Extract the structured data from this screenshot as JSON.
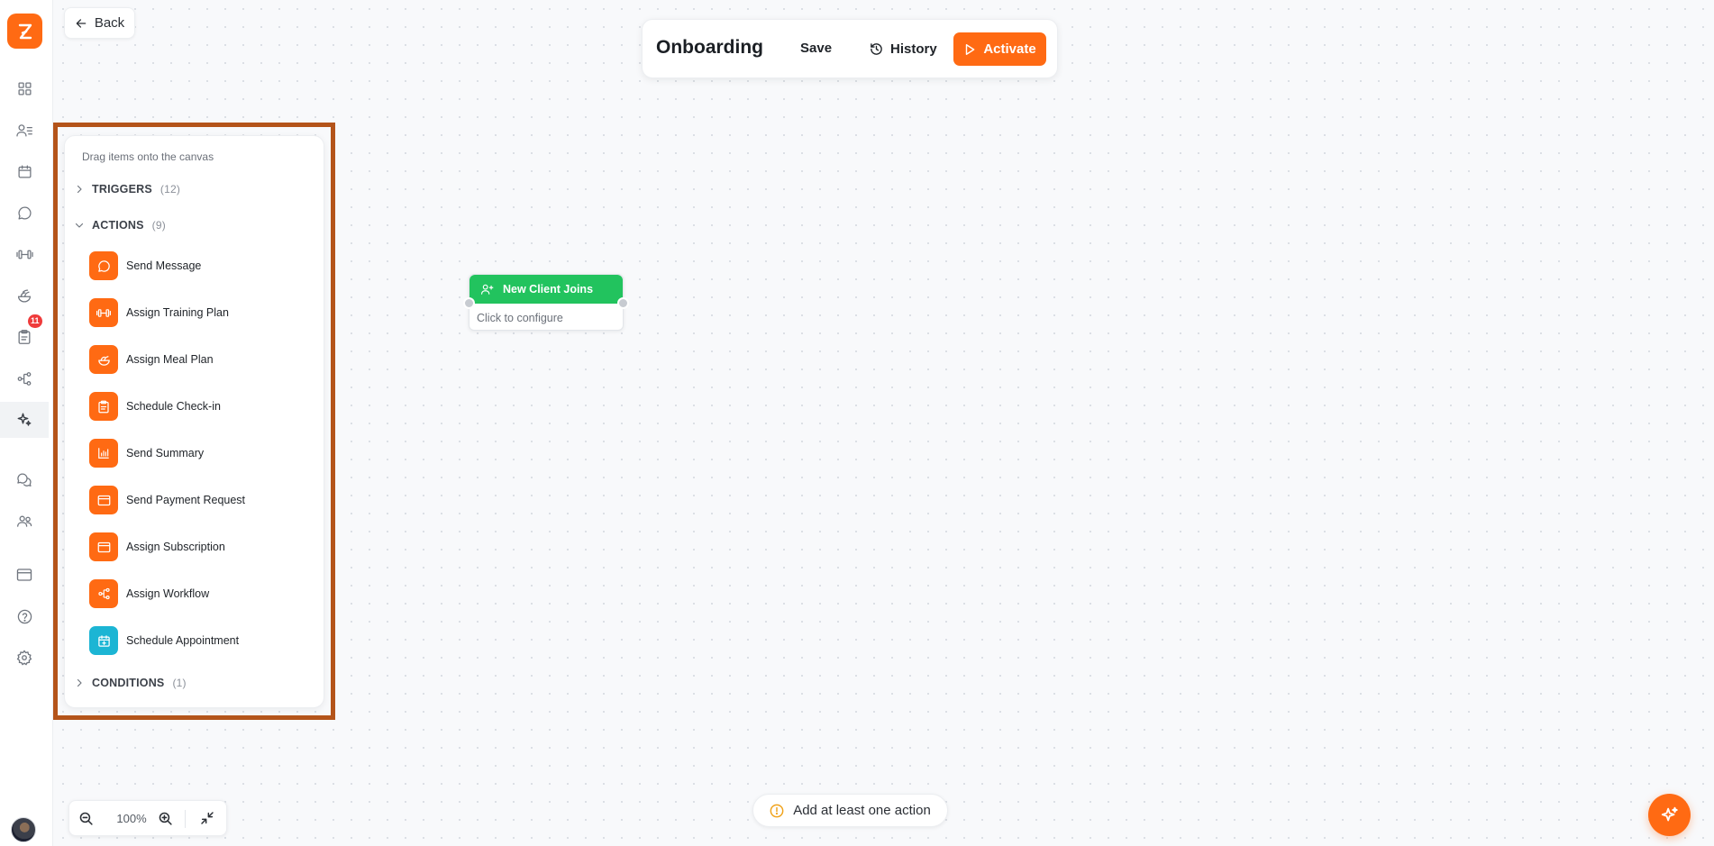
{
  "app": {
    "accent_color": "#ff6a13",
    "success_color": "#22c35e",
    "info_color": "#1cb5d4",
    "logo_icon": "brand-logo-icon"
  },
  "nav": {
    "items": [
      {
        "icon": "dashboard-icon"
      },
      {
        "icon": "clients-icon"
      },
      {
        "icon": "calendar-icon"
      },
      {
        "icon": "messages-icon"
      },
      {
        "icon": "training-icon"
      },
      {
        "icon": "nutrition-icon"
      },
      {
        "icon": "checkins-icon",
        "badge": "11"
      },
      {
        "icon": "workflows-icon"
      },
      {
        "icon": "automations-icon",
        "active": true
      },
      {
        "icon": "community-icon"
      },
      {
        "icon": "team-icon"
      },
      {
        "icon": "billing-icon"
      },
      {
        "icon": "help-icon"
      },
      {
        "icon": "settings-icon"
      }
    ]
  },
  "back_button": {
    "label": "Back"
  },
  "toolbar": {
    "title": "Onboarding",
    "save_label": "Save",
    "history_label": "History",
    "activate_label": "Activate"
  },
  "palette": {
    "hint": "Drag items onto the canvas",
    "sections": [
      {
        "label": "TRIGGERS",
        "count": "(12)",
        "expanded": false
      },
      {
        "label": "ACTIONS",
        "count": "(9)",
        "expanded": true
      },
      {
        "label": "CONDITIONS",
        "count": "(1)",
        "expanded": false
      }
    ],
    "actions": [
      {
        "label": "Send Message",
        "icon": "message-icon",
        "color": "#ff6a13"
      },
      {
        "label": "Assign Training Plan",
        "icon": "dumbbell-icon",
        "color": "#ff6a13"
      },
      {
        "label": "Assign Meal Plan",
        "icon": "salad-icon",
        "color": "#ff6a13"
      },
      {
        "label": "Schedule Check-in",
        "icon": "clipboard-icon",
        "color": "#ff6a13"
      },
      {
        "label": "Send Summary",
        "icon": "bar-chart-icon",
        "color": "#ff6a13"
      },
      {
        "label": "Send Payment Request",
        "icon": "credit-card-icon",
        "color": "#ff6a13"
      },
      {
        "label": "Assign Subscription",
        "icon": "credit-card-icon",
        "color": "#ff6a13"
      },
      {
        "label": "Assign Workflow",
        "icon": "workflow-icon",
        "color": "#ff6a13"
      },
      {
        "label": "Schedule Appointment",
        "icon": "calendar-plus-icon",
        "color": "#1cb5d4"
      }
    ]
  },
  "canvas": {
    "trigger_node": {
      "title": "New Client Joins",
      "subtitle": "Click to configure",
      "icon": "user-plus-icon"
    }
  },
  "zoom": {
    "level": "100%"
  },
  "warning": {
    "text": "Add at least one action"
  },
  "fab": {
    "icon": "sparkles-icon"
  }
}
